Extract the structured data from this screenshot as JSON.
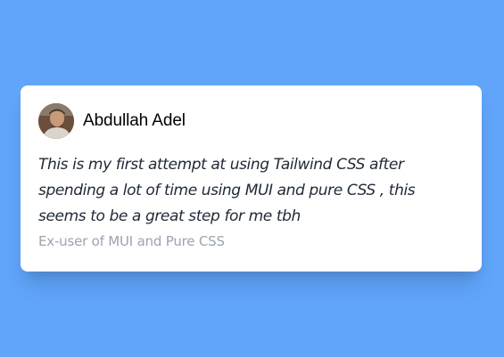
{
  "testimonial": {
    "author_name": "Abdullah Adel",
    "avatar_icon": "user-avatar",
    "quote": "This is my first attempt at using Tailwind CSS after spending a lot of time using MUI and pure CSS , this seems to be a great step for me tbh",
    "author_role": "Ex-user of MUI and Pure CSS"
  },
  "colors": {
    "background": "#60a5fa",
    "card": "#ffffff",
    "quote_text": "#1f2937",
    "role_text": "#9ca3af"
  }
}
